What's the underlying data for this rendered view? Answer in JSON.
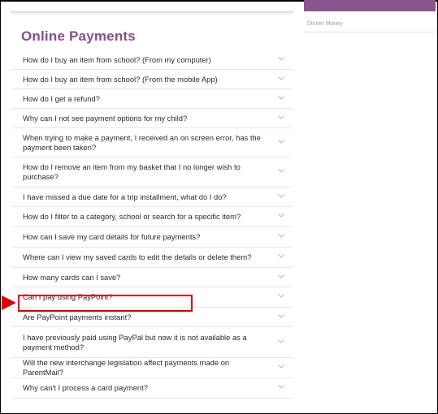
{
  "section_title": "Online Payments",
  "sidebar": {
    "link": "Dinner Money"
  },
  "faq": [
    {
      "q": "How do I buy an item from school? (From my computer)"
    },
    {
      "q": "How do I buy an item from school? (From the mobile App)"
    },
    {
      "q": "How do I get a refund?"
    },
    {
      "q": "Why can I not see payment options for my child?"
    },
    {
      "q": "When trying to make a payment, I received an on screen error, has the payment been taken?"
    },
    {
      "q": "How do I remove an item from my basket that I no longer wish to purchase?"
    },
    {
      "q": "I have missed a due date for a trip installment, what do I do?"
    },
    {
      "q": "How do I filter to a category, school or search for a specific item?"
    },
    {
      "q": "How can I save my card details for future payments?"
    },
    {
      "q": "Where can I view my saved cards to edit the details or delete them?"
    },
    {
      "q": "How many cards can I save?"
    },
    {
      "q": "Can I pay using PayPoint?"
    },
    {
      "q": "Are PayPoint payments instant?"
    },
    {
      "q": "I have previously paid using PayPal but now it is not available as a payment method?"
    },
    {
      "q": "Will the new interchange legislation affect payments made on ParentMail?"
    },
    {
      "q": "Why can't I process a card payment?"
    }
  ],
  "colors": {
    "accent": "#8a4d8a",
    "sidebar_bar": "#8a5490",
    "highlight": "#e00000"
  }
}
